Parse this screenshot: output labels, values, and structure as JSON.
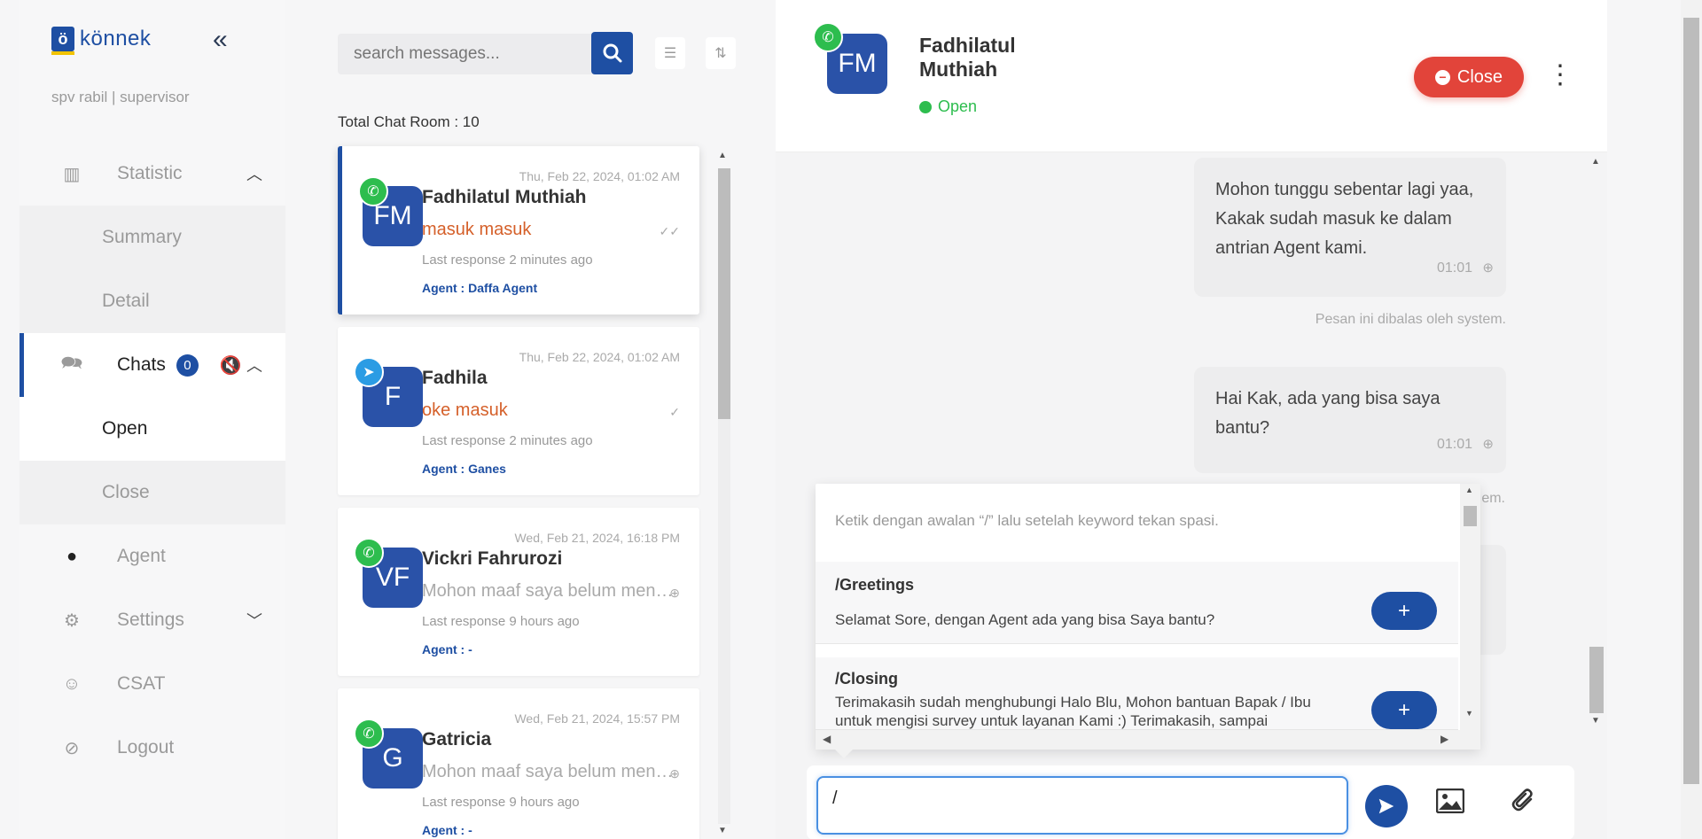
{
  "sidebar": {
    "brand": "könnek",
    "brand_mark": "ö",
    "user_line": "spv rabil | supervisor",
    "items": [
      {
        "label": "Statistic",
        "icon": "columns-icon"
      },
      {
        "label": "Summary"
      },
      {
        "label": "Detail"
      },
      {
        "label": "Chats",
        "icon": "chat-bubbles-icon",
        "badge": "0"
      },
      {
        "label": "Open"
      },
      {
        "label": "Close"
      },
      {
        "label": "Agent",
        "icon": "person-icon"
      },
      {
        "label": "Settings",
        "icon": "gear-icon"
      },
      {
        "label": "CSAT",
        "icon": "smiley-icon"
      },
      {
        "label": "Logout",
        "icon": "ban-icon"
      }
    ]
  },
  "list": {
    "search_placeholder": "search messages...",
    "total": "Total Chat Room : 10",
    "chats": [
      {
        "date": "Thu, Feb 22, 2024, 01:02 AM",
        "initials": "FM",
        "name": "Fadhilatul Muthiah",
        "message": "masuk masuk",
        "last": "Last response 2 minutes ago",
        "agent": "Agent : Daffa Agent",
        "channel": "whatsapp",
        "tick": "✓✓"
      },
      {
        "date": "Thu, Feb 22, 2024, 01:02 AM",
        "initials": "F",
        "name": "Fadhila",
        "message": "oke masuk",
        "last": "Last response 2 minutes ago",
        "agent": "Agent : Ganes",
        "channel": "telegram",
        "tick": "✓"
      },
      {
        "date": "Wed, Feb 21, 2024, 16:18 PM",
        "initials": "VF",
        "name": "Vickri Fahrurozi",
        "message": "Mohon maaf saya belum mengerti",
        "last": "Last response 9 hours ago",
        "agent": "Agent : -",
        "channel": "whatsapp",
        "tick": "⊕"
      },
      {
        "date": "Wed, Feb 21, 2024, 15:57 PM",
        "initials": "G",
        "name": "Gatricia",
        "message": "Mohon maaf saya belum mengerti",
        "last": "Last response 9 hours ago",
        "agent": "Agent : -",
        "channel": "whatsapp",
        "tick": "⊕"
      }
    ]
  },
  "chat": {
    "initials": "FM",
    "name": "Fadhilatul Muthiah",
    "status": "Open",
    "close_label": "Close",
    "messages": [
      {
        "text": "Mohon tunggu sebentar lagi yaa, Kakak sudah masuk ke dalam antrian Agent kami.",
        "time": "01:01",
        "note": "Pesan ini dibalas oleh system."
      },
      {
        "text": "Hai Kak, ada yang bisa saya bantu?",
        "time": "01:01",
        "note": "em."
      }
    ],
    "quick_reply": {
      "hint": "Ketik dengan awalan “/” lalu setelah keyword tekan spasi.",
      "items": [
        {
          "key": "/Greetings",
          "text": "Selamat Sore, dengan Agent ada yang bisa Saya bantu?"
        },
        {
          "key": "/Closing",
          "text": "Terimakasih sudah menghubungi Halo Blu, Mohon bantuan Bapak / Ibu untuk mengisi survey untuk layanan Kami :) Terimakasih, sampai"
        }
      ]
    },
    "composer_value": "/"
  },
  "colors": {
    "primary": "#1e4fa3",
    "danger": "#e2443a",
    "whatsapp": "#2dbd4e",
    "telegram": "#2b9ce4",
    "unread": "#d5602a"
  }
}
